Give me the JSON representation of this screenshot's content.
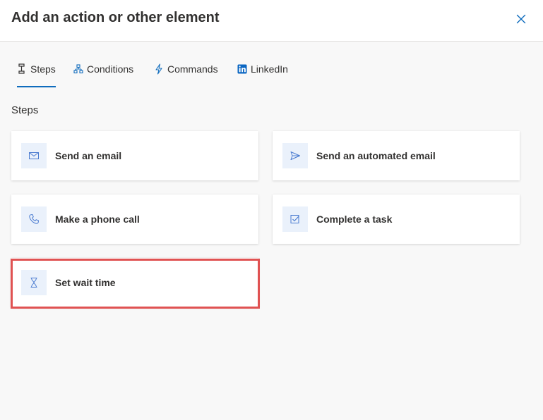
{
  "dialog": {
    "title": "Add an action or other element",
    "close_icon": "close-icon"
  },
  "tabs": [
    {
      "label": "Steps",
      "icon": "steps-icon",
      "active": true
    },
    {
      "label": "Conditions",
      "icon": "conditions-icon",
      "active": false
    },
    {
      "label": "Commands",
      "icon": "lightning-icon",
      "active": false
    },
    {
      "label": "LinkedIn",
      "icon": "linkedin-icon",
      "active": false
    }
  ],
  "section": {
    "title": "Steps"
  },
  "cards": [
    {
      "label": "Send an email",
      "icon": "mail-icon"
    },
    {
      "label": "Send an automated email",
      "icon": "send-icon"
    },
    {
      "label": "Make a phone call",
      "icon": "phone-icon"
    },
    {
      "label": "Complete a task",
      "icon": "task-checkbox-icon"
    },
    {
      "label": "Set wait time",
      "icon": "hourglass-icon",
      "highlighted": true
    }
  ],
  "colors": {
    "accent": "#0f6cbd",
    "icon_bg": "#eaf1fb",
    "highlight": "#e05252",
    "panel_bg": "#f8f8f8"
  }
}
